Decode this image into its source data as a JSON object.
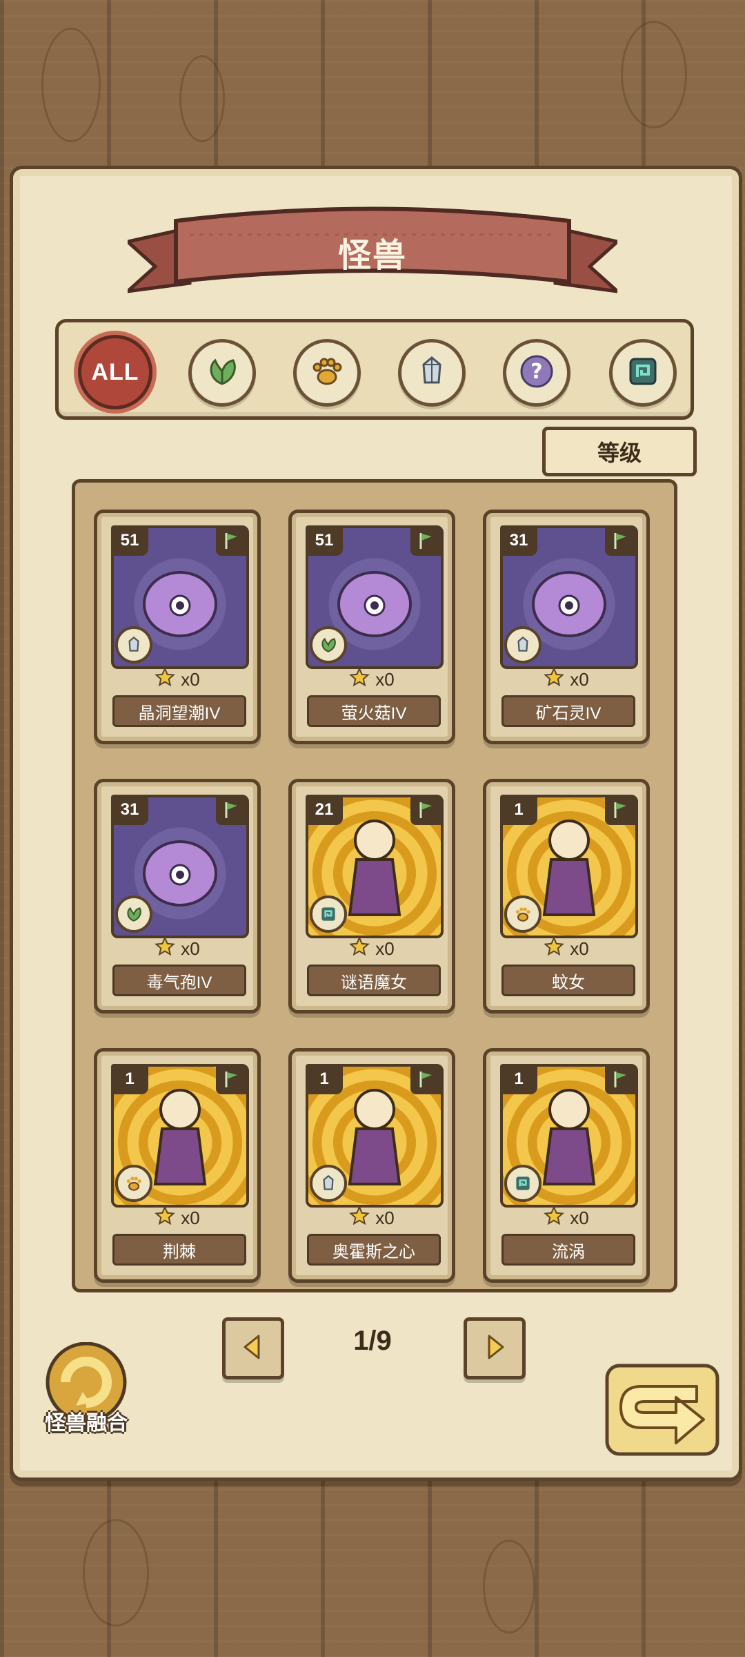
{
  "header": {
    "title": "怪兽"
  },
  "filters": [
    {
      "id": "all",
      "label": "ALL",
      "icon": "all-icon",
      "active": true
    },
    {
      "id": "plant",
      "icon": "leaf-icon",
      "active": false
    },
    {
      "id": "beast",
      "icon": "paw-icon",
      "active": false
    },
    {
      "id": "mineral",
      "icon": "crystal-icon",
      "active": false
    },
    {
      "id": "unknown",
      "icon": "question-icon",
      "active": false
    },
    {
      "id": "element",
      "icon": "swirl-icon",
      "active": false
    }
  ],
  "sort": {
    "label": "等级"
  },
  "cards": [
    {
      "name": "晶洞望潮IV",
      "level": "51",
      "count": "x0",
      "type_icon": "crystal-icon",
      "bg": "purple"
    },
    {
      "name": "萤火菇IV",
      "level": "51",
      "count": "x0",
      "type_icon": "leaf-icon",
      "bg": "purple"
    },
    {
      "name": "矿石灵IV",
      "level": "31",
      "count": "x0",
      "type_icon": "crystal-icon",
      "bg": "purple"
    },
    {
      "name": "毒气孢IV",
      "level": "31",
      "count": "x0",
      "type_icon": "leaf-icon",
      "bg": "purple"
    },
    {
      "name": "谜语魔女",
      "level": "21",
      "count": "x0",
      "type_icon": "swirl-icon",
      "bg": "gold"
    },
    {
      "name": "蚊女",
      "level": "1",
      "count": "x0",
      "type_icon": "paw-icon",
      "bg": "gold"
    },
    {
      "name": "荆棘",
      "level": "1",
      "count": "x0",
      "type_icon": "paw-icon",
      "bg": "gold"
    },
    {
      "name": "奥霍斯之心",
      "level": "1",
      "count": "x0",
      "type_icon": "crystal-icon",
      "bg": "gold"
    },
    {
      "name": "流涡",
      "level": "1",
      "count": "x0",
      "type_icon": "swirl-icon",
      "bg": "gold"
    }
  ],
  "pagination": {
    "indicator": "1/9"
  },
  "fusion": {
    "label": "怪兽融合"
  },
  "colors": {
    "accent_red": "#b0473b",
    "frame_brown": "#5b4329",
    "parchment": "#efe4c6"
  }
}
